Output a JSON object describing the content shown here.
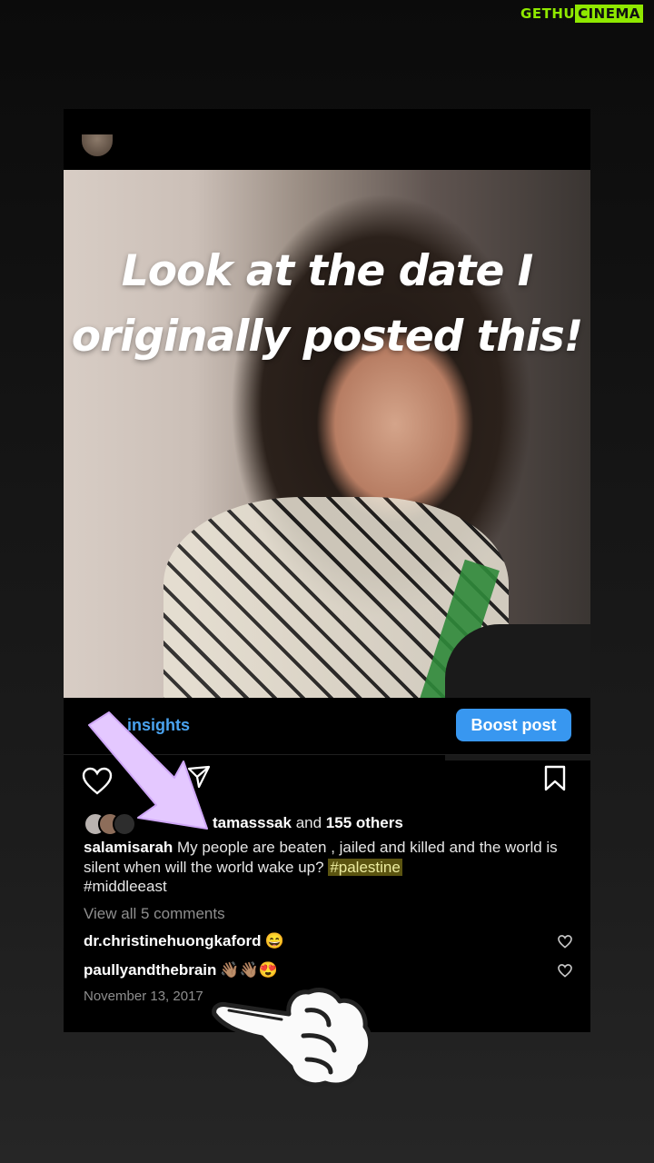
{
  "watermark": {
    "part_a": "GETHU",
    "part_b": "CINEMA"
  },
  "overlay": {
    "line1": "Look at the date I",
    "line2": "originally posted this!"
  },
  "actions": {
    "insights_label": "insights",
    "boost_label": "Boost post"
  },
  "likes": {
    "first_liker": "tamasssak",
    "and_text": " and ",
    "others": "155 others"
  },
  "caption": {
    "username": "salamisarah",
    "text": " My people are beaten , jailed and killed and the world is silent when will the world wake up? ",
    "hashtag1": "#palestine",
    "hashtag2": "#middleeast"
  },
  "comments": {
    "view_all": "View all 5 comments",
    "items": [
      {
        "user": "dr.christinehuongkaford",
        "emoji": "😄"
      },
      {
        "user": "paullyandthebrain",
        "emoji": "👋🏽👋🏽😍"
      }
    ]
  },
  "date": "November 13, 2017",
  "colors": {
    "accent_blue": "#3897f0",
    "link_blue": "#4aa3f0",
    "arrow_purple": "#e4c8ff",
    "highlight": "#5b5410",
    "watermark_green": "#8fe800"
  },
  "icons": [
    "heart-icon",
    "share-icon",
    "bookmark-icon",
    "pointing-hand-icon",
    "arrow-icon"
  ]
}
